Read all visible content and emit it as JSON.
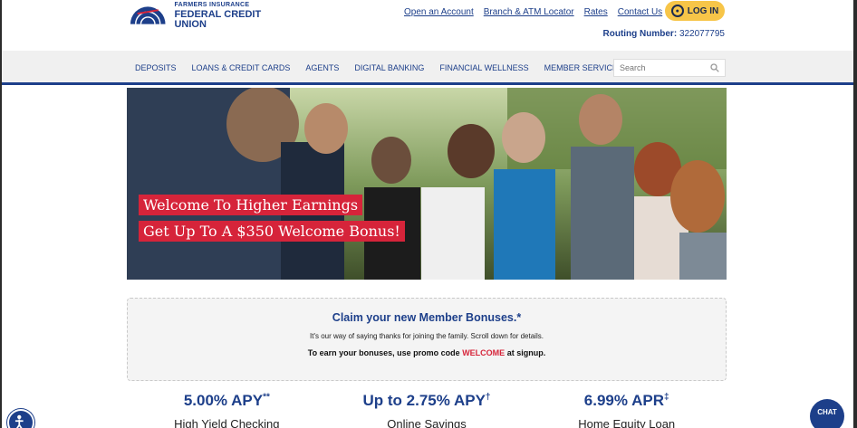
{
  "header": {
    "logo_line1": "FARMERS INSURANCE",
    "logo_line2": "FEDERAL CREDIT UNION",
    "links": [
      "Open an Account",
      "Branch & ATM Locator",
      "Rates",
      "Contact Us"
    ],
    "login_label": "LOG IN",
    "routing_label": "Routing Number:",
    "routing_number": "322077795"
  },
  "nav": {
    "items": [
      "DEPOSITS",
      "LOANS & CREDIT CARDS",
      "AGENTS",
      "DIGITAL BANKING",
      "FINANCIAL WELLNESS",
      "MEMBER SERVICES"
    ],
    "search_placeholder": "Search"
  },
  "hero": {
    "line1": "Welcome To Higher Earnings",
    "line2": "Get Up To A $350 Welcome Bonus!"
  },
  "bonus": {
    "title": "Claim your new Member Bonuses.*",
    "subtitle": "It's our way of saying thanks for joining the family. Scroll down for details.",
    "promo_prefix": "To earn your bonuses, use promo code",
    "promo_code": "WELCOME",
    "promo_suffix": "at signup."
  },
  "rates": [
    {
      "value": "5.00% APY",
      "mark": "**",
      "name": "High Yield Checking"
    },
    {
      "value": "Up to 2.75% APY",
      "mark": "†",
      "name": "Online Savings"
    },
    {
      "value": "6.99% APR",
      "mark": "‡",
      "name": "Home Equity Loan"
    }
  ],
  "chat_label": "CHAT",
  "colors": {
    "brand_blue": "#1d3f8a",
    "accent_red": "#d6243a",
    "login_yellow": "#f7c548"
  }
}
